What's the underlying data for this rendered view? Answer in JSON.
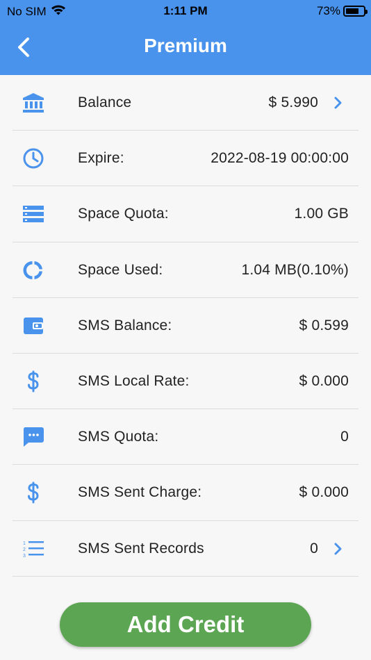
{
  "status_bar": {
    "carrier": "No SIM",
    "time": "1:11 PM",
    "battery": "73%",
    "battery_level": 0.73
  },
  "header": {
    "title": "Premium"
  },
  "rows": [
    {
      "icon": "bank-icon",
      "label": "Balance",
      "value": "$ 5.990",
      "chevron": true
    },
    {
      "icon": "clock-icon",
      "label": "Expire:",
      "value": "2022-08-19 00:00:00",
      "chevron": false
    },
    {
      "icon": "storage-icon",
      "label": "Space Quota:",
      "value": "1.00 GB",
      "chevron": false
    },
    {
      "icon": "donut-chart-icon",
      "label": "Space Used:",
      "value": "1.04 MB(0.10%)",
      "chevron": false
    },
    {
      "icon": "wallet-icon",
      "label": "SMS Balance:",
      "value": "$ 0.599",
      "chevron": false
    },
    {
      "icon": "dollar-icon",
      "label": "SMS Local Rate:",
      "value": "$ 0.000",
      "chevron": false
    },
    {
      "icon": "sms-bubble-icon",
      "label": "SMS Quota:",
      "value": "0",
      "chevron": false
    },
    {
      "icon": "dollar-icon",
      "label": "SMS Sent Charge:",
      "value": "$ 0.000",
      "chevron": false
    },
    {
      "icon": "numbered-list-icon",
      "label": "SMS Sent Records",
      "value": "0",
      "chevron": true
    }
  ],
  "actions": {
    "add_credit_label": "Add Credit"
  },
  "colors": {
    "header": "#4a93ec",
    "icon": "#4a93ec",
    "button": "#5ba553"
  }
}
